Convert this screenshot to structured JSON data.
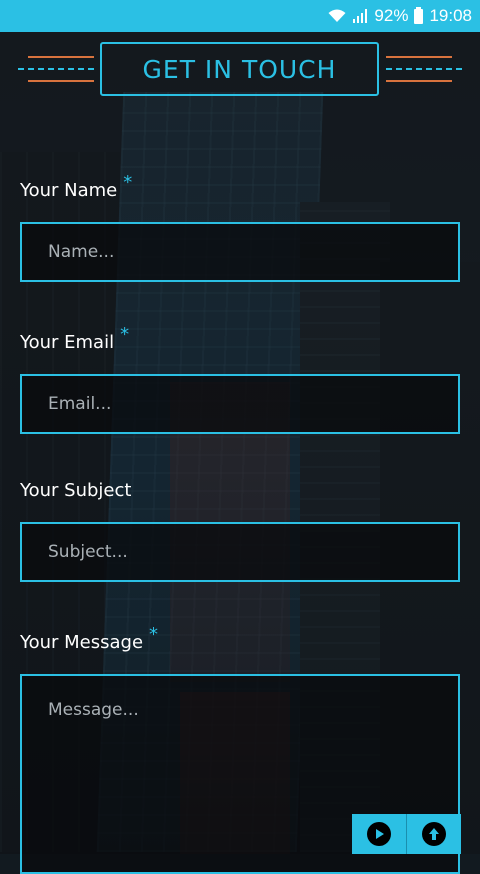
{
  "status_bar": {
    "battery": "92%",
    "time": "19:08",
    "icons": [
      "wifi-icon",
      "signal-icon",
      "battery-icon"
    ]
  },
  "header": {
    "title": "GET IN TOUCH"
  },
  "form": {
    "name": {
      "label": "Your Name",
      "required_mark": "*",
      "placeholder": "Name..."
    },
    "email": {
      "label": "Your Email",
      "required_mark": "*",
      "placeholder": "Email..."
    },
    "subject": {
      "label": "Your Subject",
      "placeholder": "Subject..."
    },
    "message": {
      "label": "Your Message",
      "required_mark": "*",
      "placeholder": "Message..."
    }
  },
  "buttons": {
    "play_icon": "play-icon",
    "up_icon": "arrow-up-icon"
  },
  "colors": {
    "accent": "#2bc0e4",
    "decor_orange": "#d8733e",
    "text": "#ffffff"
  }
}
